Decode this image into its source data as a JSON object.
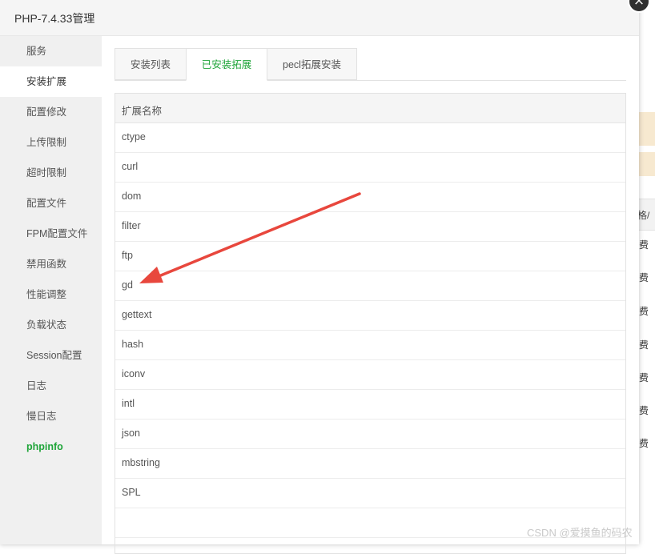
{
  "modal": {
    "title": "PHP-7.4.33管理"
  },
  "sidebar": {
    "items": [
      {
        "label": "服务"
      },
      {
        "label": "安装扩展"
      },
      {
        "label": "配置修改"
      },
      {
        "label": "上传限制"
      },
      {
        "label": "超时限制"
      },
      {
        "label": "配置文件"
      },
      {
        "label": "FPM配置文件"
      },
      {
        "label": "禁用函数"
      },
      {
        "label": "性能调整"
      },
      {
        "label": "负载状态"
      },
      {
        "label": "Session配置"
      },
      {
        "label": "日志"
      },
      {
        "label": "慢日志"
      },
      {
        "label": "phpinfo"
      }
    ],
    "active_index": 1
  },
  "tabs": [
    {
      "label": "安装列表"
    },
    {
      "label": "已安装拓展"
    },
    {
      "label": "pecl拓展安装"
    }
  ],
  "table": {
    "header": "扩展名称",
    "rows": [
      "ctype",
      "curl",
      "dom",
      "filter",
      "ftp",
      "gd",
      "gettext",
      "hash",
      "iconv",
      "intl",
      "json",
      "mbstring",
      "SPL"
    ]
  },
  "background": {
    "header_fragment": "格/",
    "cell_text": "费"
  },
  "watermark": "CSDN @爱摸鱼的码农",
  "colors": {
    "accent": "#20a53a",
    "arrow": "#e8473d"
  }
}
